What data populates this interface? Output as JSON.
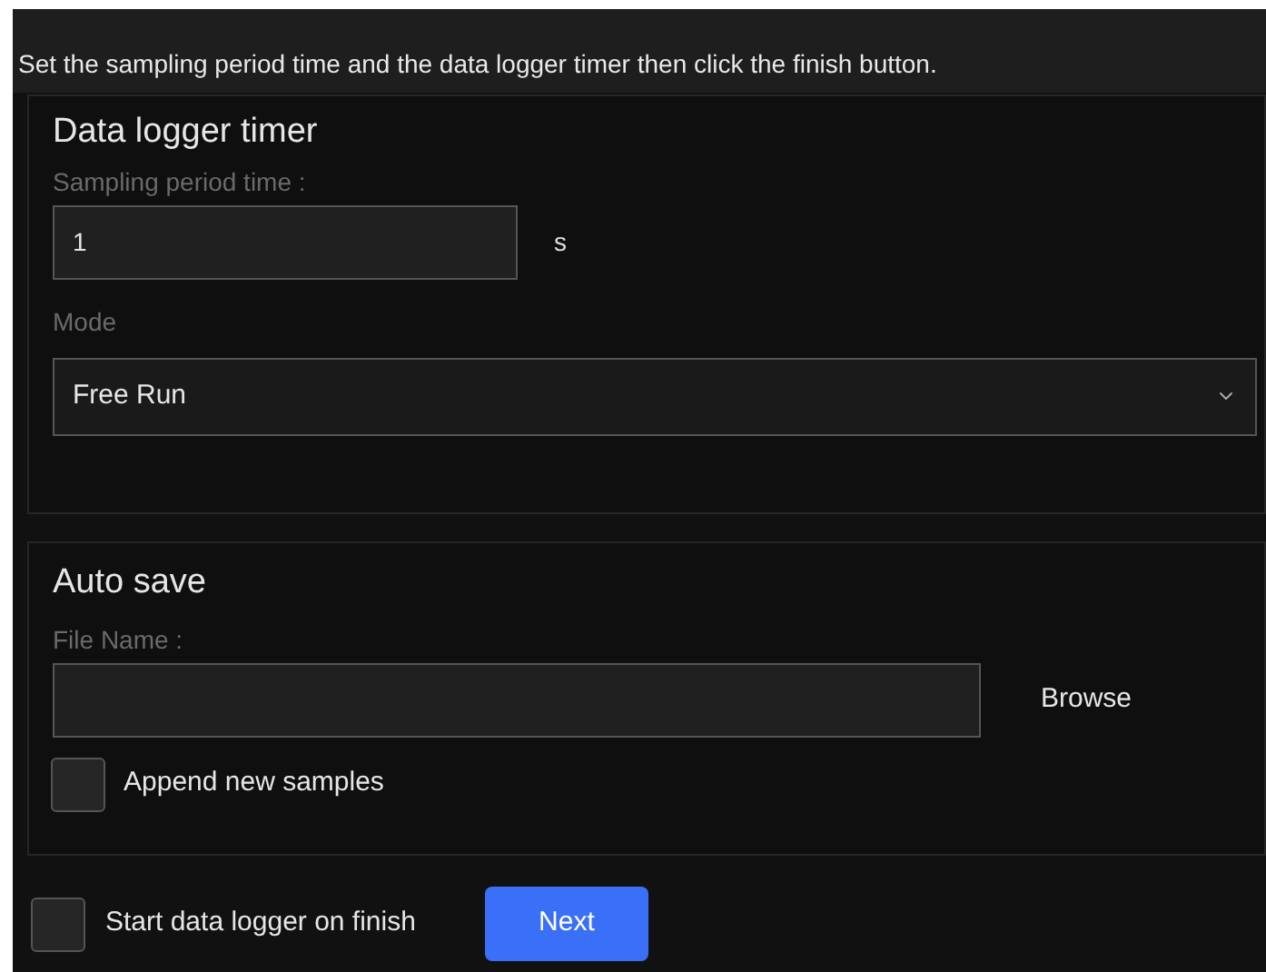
{
  "instruction": "Set the sampling period time and the data logger timer then click the finish button.",
  "timer": {
    "title": "Data logger timer",
    "sampling_label": "Sampling period time :",
    "sampling_value": "1",
    "unit": "s",
    "mode_label": "Mode",
    "mode_value": "Free Run"
  },
  "auto_save": {
    "title": "Auto save",
    "file_label": "File Name :",
    "browse": "Browse",
    "append": {
      "label": "Append new samples",
      "checked": false
    }
  },
  "start_on_finish": {
    "label": "Start data logger on finish",
    "checked": false
  },
  "next_button": "Next"
}
